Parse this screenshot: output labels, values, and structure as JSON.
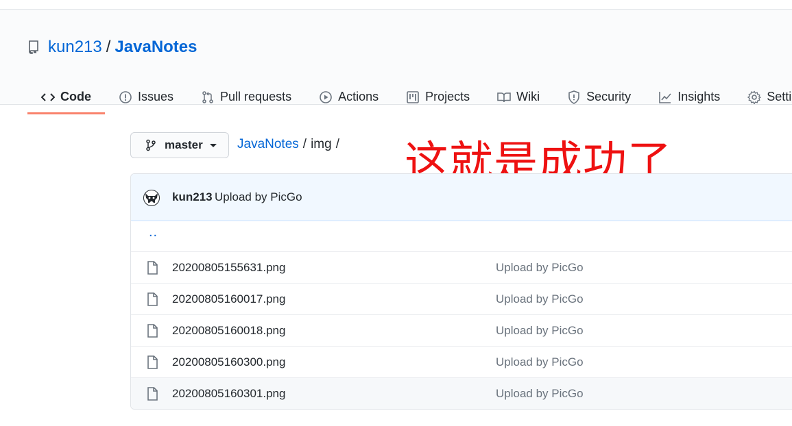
{
  "repo": {
    "owner": "kun213",
    "separator": "/",
    "name": "JavaNotes"
  },
  "tabs": [
    {
      "label": "Code",
      "icon": "code-icon",
      "selected": true
    },
    {
      "label": "Issues",
      "icon": "issue-icon"
    },
    {
      "label": "Pull requests",
      "icon": "pull-request-icon"
    },
    {
      "label": "Actions",
      "icon": "play-icon"
    },
    {
      "label": "Projects",
      "icon": "project-icon"
    },
    {
      "label": "Wiki",
      "icon": "book-icon"
    },
    {
      "label": "Security",
      "icon": "shield-icon"
    },
    {
      "label": "Insights",
      "icon": "graph-icon"
    },
    {
      "label": "Settings",
      "icon": "gear-icon"
    }
  ],
  "branch": {
    "label": "master",
    "icon": "git-branch-icon"
  },
  "breadcrumb": {
    "repo": "JavaNotes",
    "sep1": "/",
    "folder": "img",
    "sep2": "/"
  },
  "annotation": "这就是成功了",
  "commit": {
    "author": "kun213",
    "message": "Upload by PicGo"
  },
  "parent_link": "..",
  "files": [
    {
      "name": "20200805155631.png",
      "commit": "Upload by PicGo"
    },
    {
      "name": "20200805160017.png",
      "commit": "Upload by PicGo"
    },
    {
      "name": "20200805160018.png",
      "commit": "Upload by PicGo"
    },
    {
      "name": "20200805160300.png",
      "commit": "Upload by PicGo"
    },
    {
      "name": "20200805160301.png",
      "commit": "Upload by PicGo"
    }
  ],
  "colors": {
    "link": "#0366d6",
    "tab_underline": "#f9826c",
    "annotation": "#ee1111",
    "commit_bar": "#f1f8ff"
  }
}
